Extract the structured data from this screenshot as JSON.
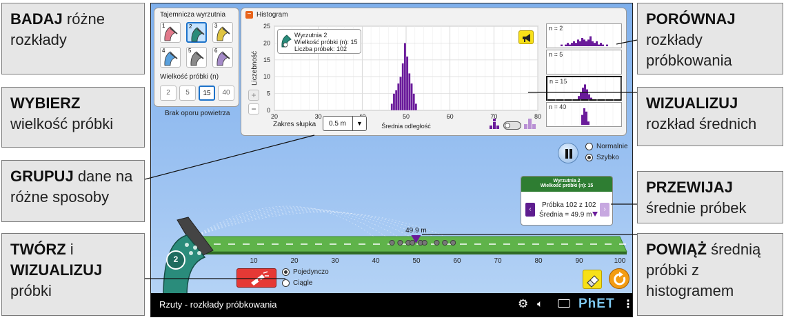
{
  "app": {
    "title": "Rzuty - rozkłady próbkowania",
    "brand": "PhET"
  },
  "launchers": {
    "title": "Tajemnicza wyrzutnia",
    "items": [
      {
        "num": "1",
        "color": "#e27a8b"
      },
      {
        "num": "2",
        "color": "#2a8c7b"
      },
      {
        "num": "3",
        "color": "#e0c542"
      },
      {
        "num": "4",
        "color": "#5aa1dd"
      },
      {
        "num": "5",
        "color": "#8a8a8a"
      },
      {
        "num": "6",
        "color": "#a58bc9"
      }
    ],
    "selected": "2"
  },
  "sample_size": {
    "title": "Wielkość próbki (n)",
    "options": [
      "2",
      "5",
      "15",
      "40"
    ],
    "selected": "15"
  },
  "air_resistance": "Brak oporu powietrza",
  "histogram": {
    "title": "Histogram",
    "legend_line1": "Wyrzutnia 2",
    "legend_line2": "Wielkość próbki (n): 15",
    "legend_line3": "Liczba próbek: 102",
    "ylabel": "Liczebność",
    "xlabel": "Średnia odległość",
    "zoom_in": "+",
    "zoom_out": "−",
    "bin_label": "Zakres słupka",
    "bin_value": "0.5 m"
  },
  "chart_data": {
    "type": "bar",
    "title": "",
    "xlabel": "Średnia odległość",
    "ylabel": "Liczebność",
    "x_ticks": [
      20,
      30,
      40,
      50,
      60,
      70,
      80
    ],
    "y_ticks": [
      0,
      5,
      10,
      15,
      20,
      25
    ],
    "xlim": [
      20,
      80
    ],
    "ylim": [
      0,
      25
    ],
    "bin_width": 0.5,
    "bins": [
      {
        "x": 46.5,
        "count": 2
      },
      {
        "x": 47.0,
        "count": 5
      },
      {
        "x": 47.5,
        "count": 6
      },
      {
        "x": 48.0,
        "count": 8
      },
      {
        "x": 48.5,
        "count": 10
      },
      {
        "x": 49.0,
        "count": 14
      },
      {
        "x": 49.5,
        "count": 20
      },
      {
        "x": 50.0,
        "count": 16
      },
      {
        "x": 50.5,
        "count": 11
      },
      {
        "x": 51.0,
        "count": 8
      },
      {
        "x": 51.5,
        "count": 5
      },
      {
        "x": 52.0,
        "count": 2
      }
    ],
    "bar_color": "#6a1b9a"
  },
  "mini_histograms": [
    {
      "label": "n = 2"
    },
    {
      "label": "n = 5"
    },
    {
      "label": "n = 15"
    },
    {
      "label": "n = 40"
    }
  ],
  "speed": {
    "normal": "Normalnie",
    "fast": "Szybko",
    "selected": "fast"
  },
  "sample_info": {
    "header1": "Wyrzutnia 2",
    "header2": "Wielkość próbki (n): 15",
    "line1": "Próbka 102 z 102",
    "line2": "Średnia = 49.9 m"
  },
  "field": {
    "ticks": [
      "10",
      "20",
      "30",
      "40",
      "50",
      "60",
      "70",
      "80",
      "90",
      "100"
    ],
    "mean_label": "49.9 m",
    "launcher_num": "2"
  },
  "mode": {
    "single": "Pojedynczo",
    "continuous": "Ciągle",
    "selected": "single"
  },
  "callouts": {
    "explore_bold": "BADAJ",
    "explore_rest": "różne rozkłady",
    "choose_bold": "WYBIERZ",
    "choose_rest": "wielkość próbki",
    "group_bold": "GRUPUJ",
    "group_rest": "dane na różne sposoby",
    "create_bold": "TWÓRZ",
    "create_and": "i",
    "create_bold2": "WIZUALIZUJ",
    "create_rest": "próbki",
    "compare_bold": "PORÓWNAJ",
    "compare_rest": "rozkłady próbkowania",
    "visualize_bold": "WIZUALIZUJ",
    "visualize_rest": "rozkład średnich",
    "scroll_bold": "PRZEWIJAJ",
    "scroll_rest": "średnie próbek",
    "link_bold": "POWIĄŻ",
    "link_rest": "średnią próbki z histogramem"
  },
  "colors": {
    "accent": "#1d72c9",
    "purple": "#6a1b9a",
    "green": "#2e7d32",
    "field": "#5fb34a",
    "fire": "#e53935",
    "reset": "#f39c12"
  }
}
